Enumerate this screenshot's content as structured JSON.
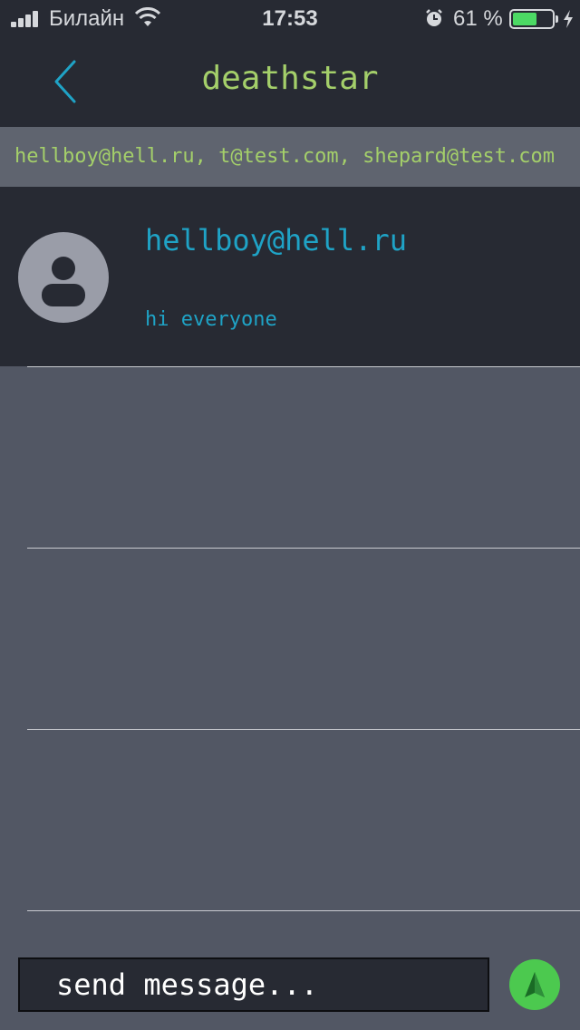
{
  "status_bar": {
    "carrier": "Билайн",
    "time": "17:53",
    "battery_percent_text": "61 %",
    "battery_level": 0.61,
    "icons": [
      "signal-icon",
      "wifi-icon",
      "alarm-icon",
      "battery-icon",
      "charging-icon"
    ]
  },
  "header": {
    "title": "deathstar",
    "back_icon": "chevron-left-icon"
  },
  "participants": {
    "text": "hellboy@hell.ru, t@test.com, shepard@test.com"
  },
  "messages": [
    {
      "sender": "hellboy@hell.ru",
      "text": "hi everyone",
      "avatar_icon": "user-avatar-icon"
    }
  ],
  "composer": {
    "placeholder": "send message...",
    "send_icon": "send-icon"
  },
  "colors": {
    "accent_green": "#a4cf6a",
    "accent_blue": "#1fa3c6",
    "send_button": "#4cc94f",
    "dark_panel": "#272a33",
    "background": "#525764"
  }
}
